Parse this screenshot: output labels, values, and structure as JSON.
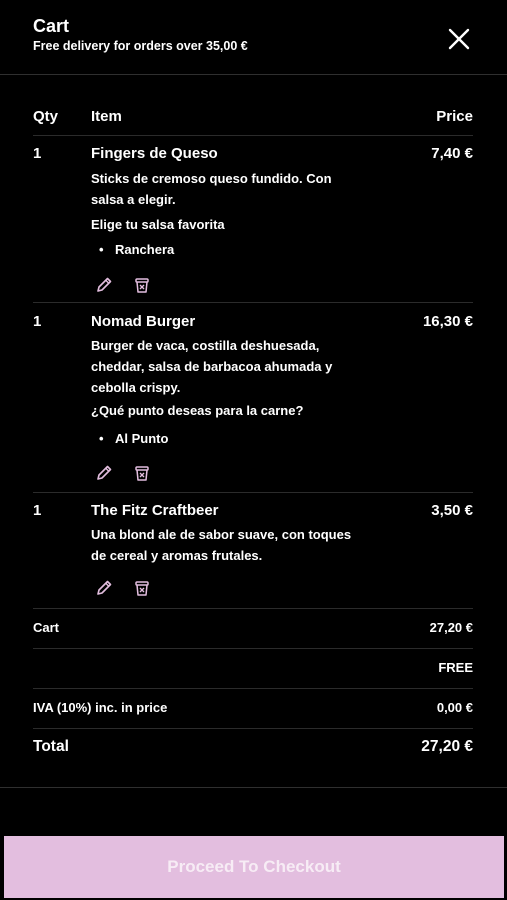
{
  "header": {
    "title": "Cart",
    "subtitle": "Free delivery for orders over 35,00 €",
    "close_icon": "close-icon"
  },
  "columns": {
    "qty": "Qty",
    "item": "Item",
    "price": "Price"
  },
  "items": [
    {
      "qty": "1",
      "name": "Fingers de Queso",
      "price": "7,40 €",
      "description": "Sticks de cremoso queso fundido. Con salsa a elegir.",
      "option_question": "Elige tu salsa favorita",
      "option_value": "Ranchera"
    },
    {
      "qty": "1",
      "name": "Nomad Burger",
      "price": "16,30 €",
      "description": "Burger de vaca, costilla deshuesada, cheddar, salsa de barbacoa ahumada y cebolla crispy.",
      "option_question": "¿Qué punto deseas para la carne?",
      "option_value": "Al Punto"
    },
    {
      "qty": "1",
      "name": "The Fitz Craftbeer",
      "price": "3,50 €",
      "description": "Una blond ale de sabor suave, con toques de cereal y aromas frutales."
    }
  ],
  "summary": {
    "cart_label": "Cart",
    "cart_value": "27,20 €",
    "delivery_label": "",
    "delivery_value": "FREE",
    "iva_label": "IVA (10%) inc. in price",
    "iva_value": "0,00 €",
    "total_label": "Total",
    "total_value": "27,20 €"
  },
  "checkout": {
    "label": "Proceed To Checkout"
  },
  "colors": {
    "background": "#000000",
    "text": "#ffffff",
    "checkout_bg": "#e3bedf",
    "icon_accent": "#e3bedf"
  }
}
